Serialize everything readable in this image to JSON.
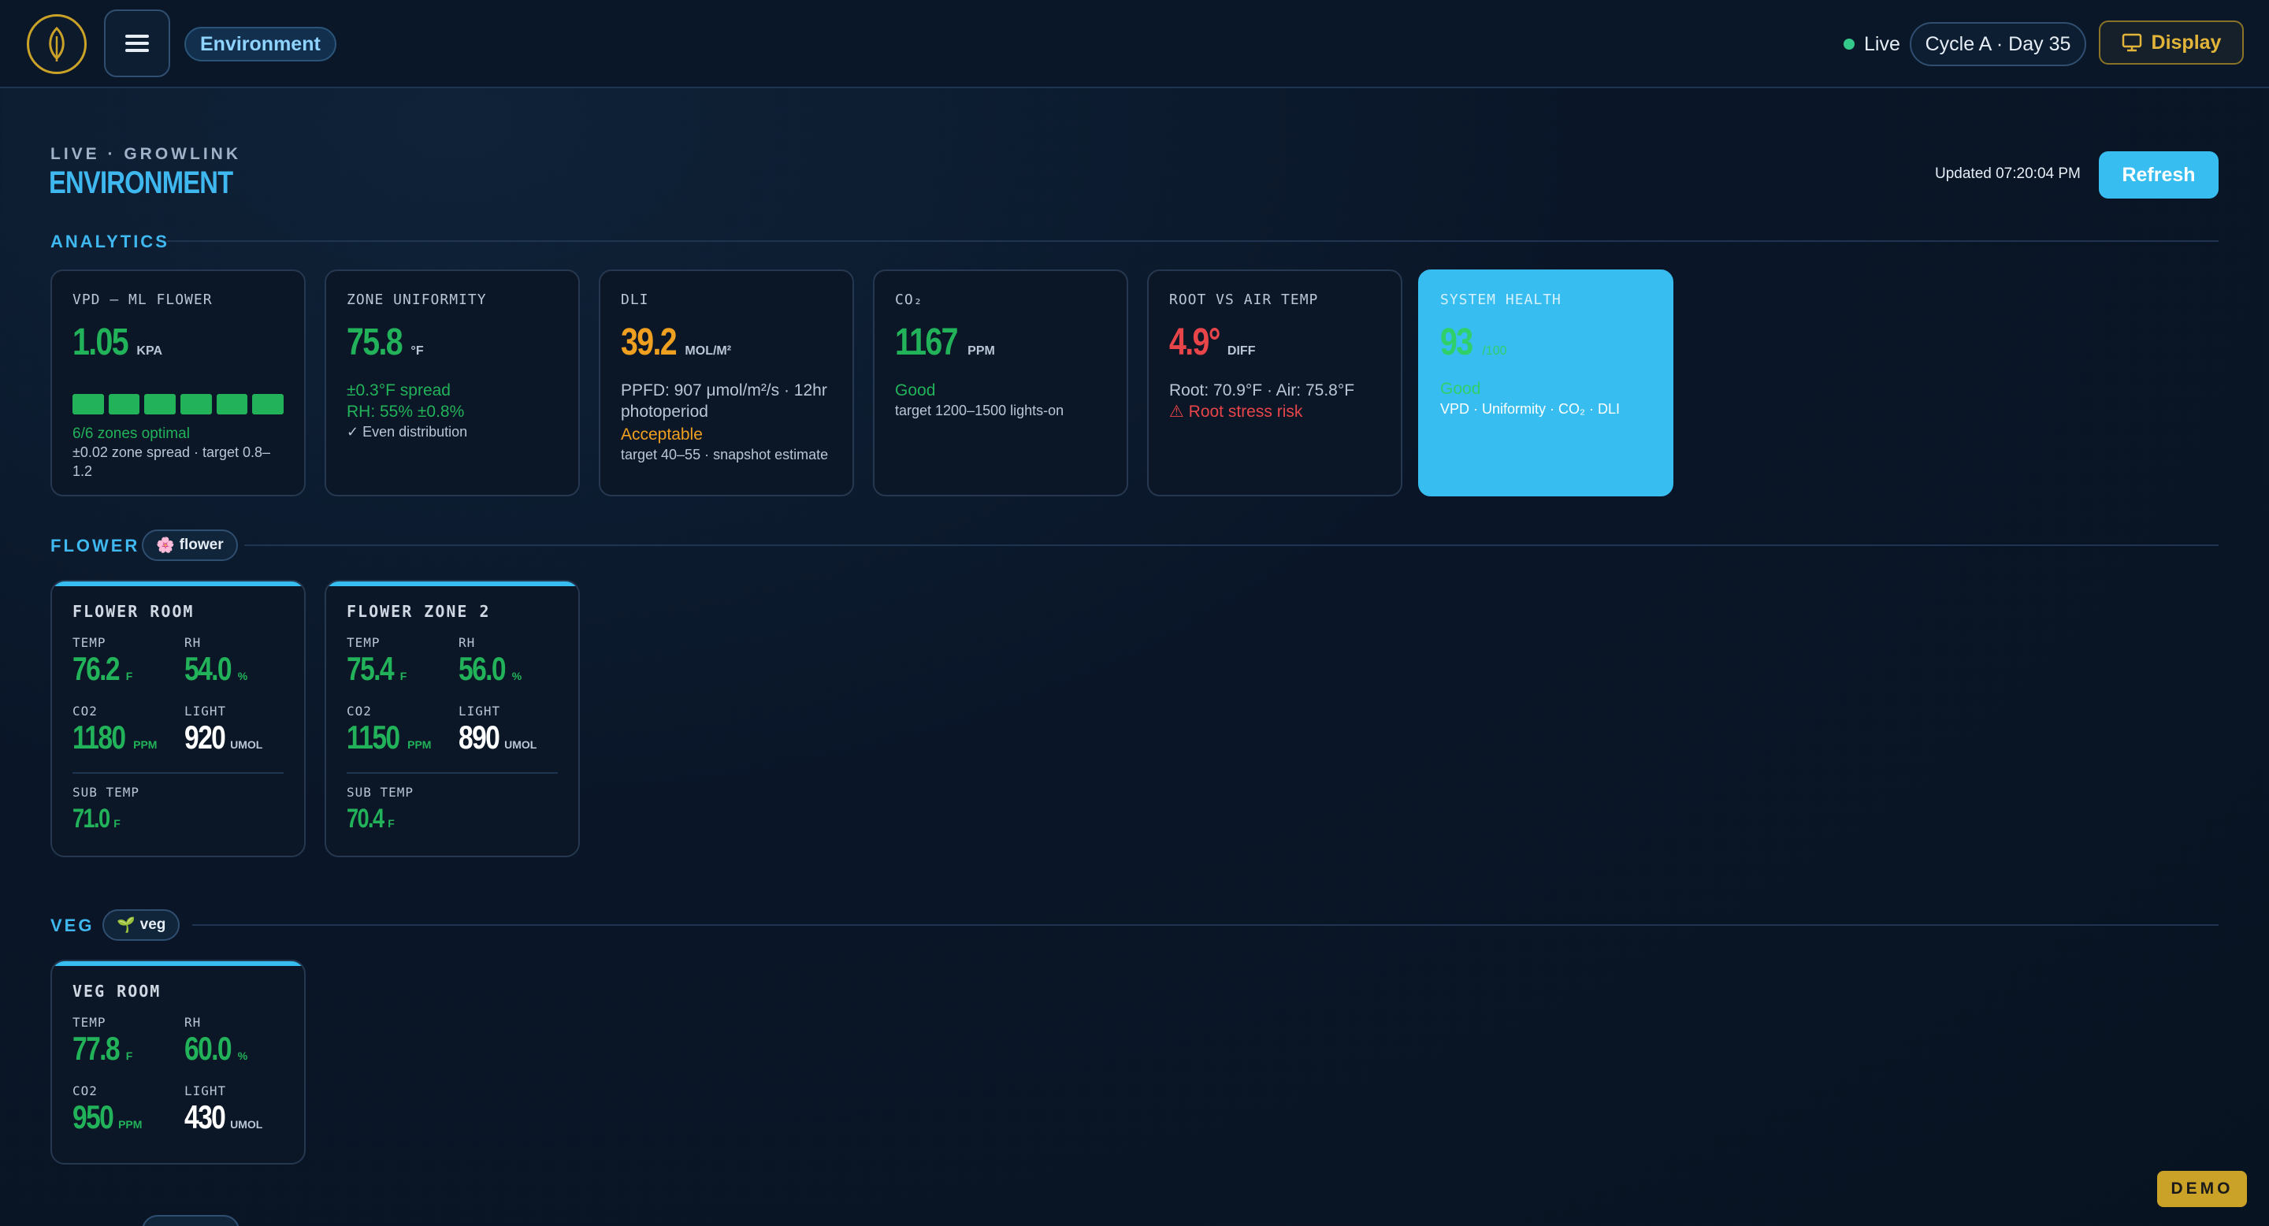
{
  "topbar": {
    "section_pill": "Environment",
    "live_label": "Live",
    "cycle_label": "Cycle A · Day 35",
    "display_label": "Display"
  },
  "header": {
    "eyebrow": "LIVE · GROWLINK",
    "title": "ENVIRONMENT",
    "updated": "Updated 07:20:04 PM",
    "refresh_label": "Refresh"
  },
  "analytics": {
    "section_label": "ANALYTICS",
    "cards": [
      {
        "label": "VPD — ML FLOWER",
        "value": "1.05",
        "unit": "KPA",
        "zones_text": "6/6 zones optimal",
        "spread_text": "±0.02 zone spread · target 0.8–1.2",
        "zone_bars": 6
      },
      {
        "label": "ZONE UNIFORMITY",
        "value": "75.8",
        "unit": "°F",
        "line1": "±0.3°F spread",
        "line2": "RH: 55% ±0.8%",
        "line3": "✓ Even distribution"
      },
      {
        "label": "DLI",
        "value": "39.2",
        "unit": "MOL/M²",
        "line1": "PPFD: 907 μmol/m²/s · 12hr photoperiod",
        "status": "Acceptable",
        "note": "target 40–55 · snapshot estimate"
      },
      {
        "label": "CO₂",
        "value": "1167",
        "unit": "PPM",
        "status": "Good",
        "note": "target 1200–1500 lights-on"
      },
      {
        "label": "ROOT VS AIR TEMP",
        "value": "4.9°",
        "unit": "DIFF",
        "line1": "Root: 70.9°F · Air: 75.8°F",
        "warning": "⚠ Root stress risk"
      },
      {
        "label": "SYSTEM HEALTH",
        "value": "93",
        "unit": "/100",
        "status": "Good",
        "note": "VPD · Uniformity · CO₂ · DLI"
      }
    ]
  },
  "flower": {
    "section_label": "FLOWER",
    "tag": "flower",
    "tag_icon": "🌸",
    "zones": [
      {
        "name": "FLOWER ROOM",
        "temp": "76.2",
        "temp_unit": "F",
        "rh": "54.0",
        "rh_unit": "%",
        "co2": "1180",
        "co2_unit": "PPM",
        "light": "920",
        "light_unit": "UMOL",
        "sub_temp": "71.0",
        "sub_temp_unit": "F"
      },
      {
        "name": "FLOWER ZONE 2",
        "temp": "75.4",
        "temp_unit": "F",
        "rh": "56.0",
        "rh_unit": "%",
        "co2": "1150",
        "co2_unit": "PPM",
        "light": "890",
        "light_unit": "UMOL",
        "sub_temp": "70.4",
        "sub_temp_unit": "F"
      }
    ]
  },
  "veg": {
    "section_label": "VEG",
    "tag": "veg",
    "tag_icon": "🌱",
    "zones": [
      {
        "name": "VEG ROOM",
        "temp": "77.8",
        "temp_unit": "F",
        "rh": "60.0",
        "rh_unit": "%",
        "co2": "950",
        "co2_unit": "PPM",
        "light": "430",
        "light_unit": "UMOL"
      }
    ]
  },
  "metric_labels": {
    "temp": "TEMP",
    "rh": "RH",
    "co2": "CO2",
    "light": "LIGHT",
    "sub_temp": "SUB TEMP"
  },
  "demo_badge": "DEMO",
  "colors": {
    "accent": "#38bdf0",
    "good": "#22b35a",
    "warn": "#f0a020",
    "bad": "#e8454a",
    "brand_gold": "#c9a227"
  }
}
